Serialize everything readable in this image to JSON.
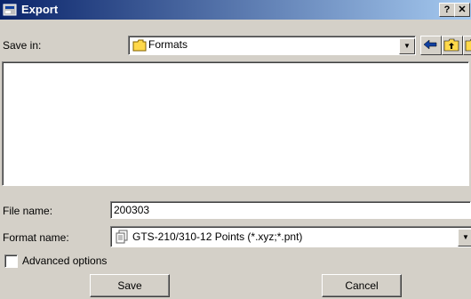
{
  "window": {
    "title": "Export"
  },
  "titlebar": {
    "help_label": "?",
    "close_label": "✕"
  },
  "save_in": {
    "label": "Save in:",
    "value": "Formats"
  },
  "toolbar": {
    "icons": [
      "back-arrow-icon",
      "up-folder-icon",
      "new-folder-icon"
    ]
  },
  "file_name": {
    "label": "File name:",
    "value": "200303"
  },
  "format_name": {
    "label": "Format name:",
    "value": "GTS-210/310-12 Points (*.xyz;*.pnt)"
  },
  "advanced": {
    "label": "Advanced options",
    "checked": false
  },
  "buttons": {
    "save": "Save",
    "cancel": "Cancel"
  },
  "colors": {
    "title_start": "#0a246a",
    "title_end": "#a6caf0",
    "face": "#d4d0c8"
  }
}
